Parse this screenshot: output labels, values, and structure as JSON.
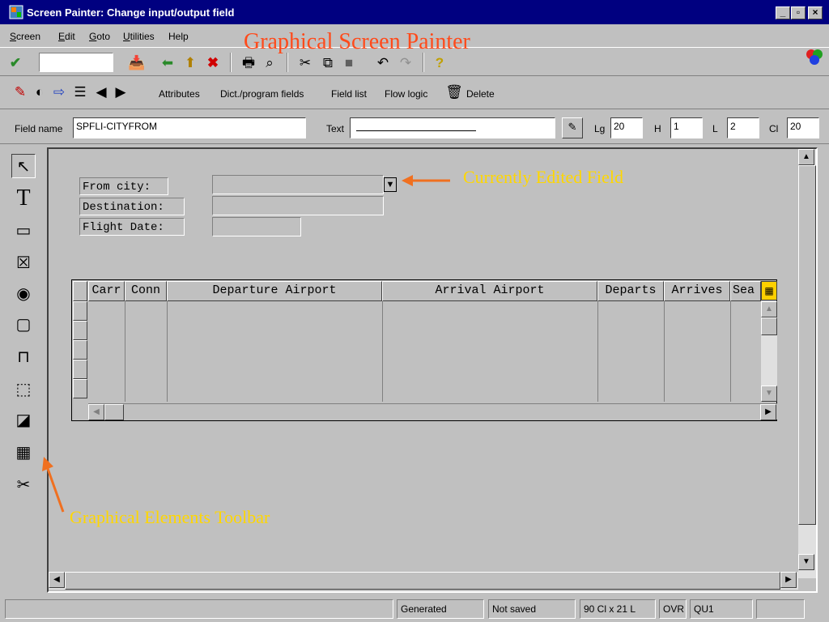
{
  "window": {
    "title": "Screen Painter:  Change input/output field",
    "minimize": "_",
    "maximize": "▫",
    "close": "×"
  },
  "menu": {
    "items": [
      {
        "mnemonic": "S",
        "rest": "creen"
      },
      {
        "mnemonic": "E",
        "rest": "dit"
      },
      {
        "mnemonic": "G",
        "rest": "oto"
      },
      {
        "mnemonic": "U",
        "rest": "tilities"
      },
      {
        "mnemonic": "",
        "rest": "Help"
      }
    ]
  },
  "overlay_title": "Graphical Screen Painter",
  "toolbar2": {
    "attributes": "Attributes",
    "dict_fields": "Dict./program fields",
    "field_list": "Field list",
    "flow_logic": "Flow logic",
    "delete": "Delete"
  },
  "field_attrs": {
    "field_name_label": "Field name",
    "field_name_value": "SPFLI-CITYFROM",
    "text_label": "Text",
    "text_value": "",
    "lg_label": "Lg",
    "lg_value": "20",
    "h_label": "H",
    "h_value": "1",
    "l_label": "L",
    "l_value": "2",
    "cl_label": "Cl",
    "cl_value": "20"
  },
  "screen_fields": {
    "from_city": "From city:",
    "destination": "Destination:",
    "flight_date": "Flight Date:"
  },
  "table_control": {
    "columns": [
      "Carr",
      "Conn",
      "Departure Airport",
      "Arrival Airport",
      "Departs",
      "Arrives",
      "Sea"
    ],
    "rows": 5
  },
  "annotations": {
    "edited_field": "Currently Edited Field",
    "toolbar": "Graphical Elements Toolbar",
    "color": "#ffd700",
    "arrow_color": "#f07020"
  },
  "status": {
    "state1": "Generated",
    "state2": "Not saved",
    "position": "90 Cl x 21 L",
    "mode": "OVR",
    "client": "QU1"
  }
}
